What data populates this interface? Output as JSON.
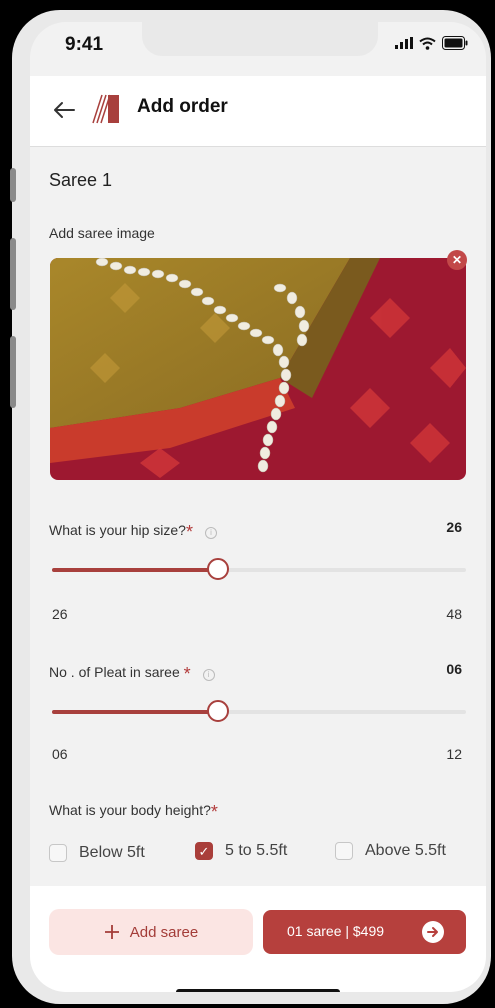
{
  "status": {
    "time": "9:41"
  },
  "header": {
    "title": "Add order"
  },
  "section": {
    "title": "Saree 1"
  },
  "image": {
    "label": "Add saree image"
  },
  "hip": {
    "label": "What is your hip size?",
    "value": "26",
    "min": "26",
    "max": "48",
    "fraction": 0.4
  },
  "pleat": {
    "label": "No . of Pleat in saree",
    "value": "06",
    "min": "06",
    "max": "12",
    "fraction": 0.4
  },
  "height": {
    "label": "What is your body height?",
    "options": [
      {
        "label": "Below 5ft",
        "checked": false
      },
      {
        "label": "5 to 5.5ft",
        "checked": true
      },
      {
        "label": "Above 5.5ft",
        "checked": false
      }
    ]
  },
  "actions": {
    "add_label": "Add saree",
    "pay_label": "01 saree | $499"
  },
  "colors": {
    "accent": "#a8403d",
    "accent_light": "#fbe5e3"
  }
}
